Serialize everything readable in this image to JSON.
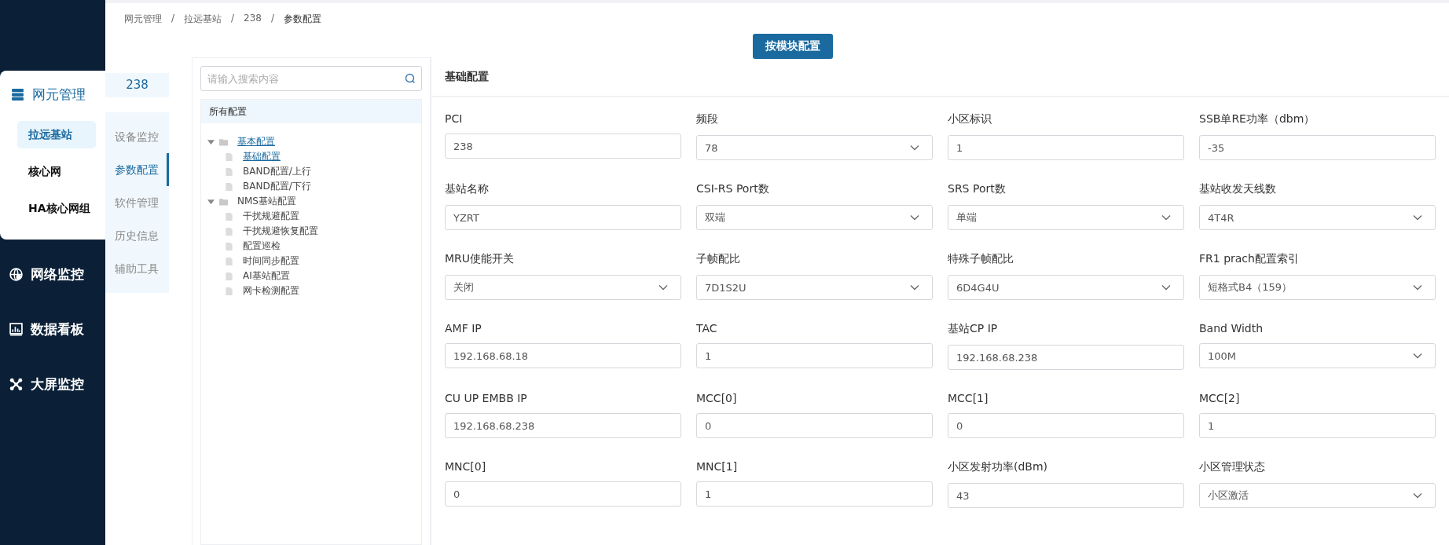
{
  "sidebar": {
    "items": [
      {
        "label": "网元管理",
        "expanded": true,
        "children": [
          {
            "label": "拉远基站",
            "selected": true
          },
          {
            "label": "核心网",
            "selected": false
          },
          {
            "label": "HA核心网组",
            "selected": false
          }
        ]
      },
      {
        "label": "网络监控",
        "expanded": false
      },
      {
        "label": "数据看板",
        "expanded": false
      },
      {
        "label": "大屏监控",
        "expanded": false
      }
    ]
  },
  "breadcrumb": {
    "separator": "/",
    "items": [
      "网元管理",
      "拉远基站",
      "238",
      "参数配置"
    ]
  },
  "module_button": "按模块配置",
  "subnav": {
    "title": "238",
    "items": [
      {
        "label": "设备监控",
        "selected": false
      },
      {
        "label": "参数配置",
        "selected": true
      },
      {
        "label": "软件管理",
        "selected": false
      },
      {
        "label": "历史信息",
        "selected": false
      },
      {
        "label": "辅助工具",
        "selected": false
      }
    ]
  },
  "tree": {
    "search": {
      "placeholder": "请输入搜索内容"
    },
    "header": "所有配置",
    "nodes": [
      {
        "label": "基本配置",
        "selected": true,
        "expanded": true,
        "children": [
          {
            "label": "基础配置",
            "selected": true
          },
          {
            "label": "BAND配置/上行",
            "selected": false
          },
          {
            "label": "BAND配置/下行",
            "selected": false
          }
        ]
      },
      {
        "label": "NMS基站配置",
        "selected": false,
        "expanded": true,
        "children": [
          {
            "label": "干扰规避配置",
            "selected": false
          },
          {
            "label": "干扰规避恢复配置",
            "selected": false
          },
          {
            "label": "配置巡检",
            "selected": false
          },
          {
            "label": "时间同步配置",
            "selected": false
          },
          {
            "label": "AI基站配置",
            "selected": false
          },
          {
            "label": "网卡检测配置",
            "selected": false
          }
        ]
      }
    ]
  },
  "form": {
    "title": "基础配置",
    "fields": [
      {
        "label": "PCI",
        "kind": "input",
        "value": "238"
      },
      {
        "label": "频段",
        "kind": "select",
        "value": "78"
      },
      {
        "label": "小区标识",
        "kind": "input",
        "value": "1"
      },
      {
        "label": "SSB单RE功率（dbm）",
        "kind": "input",
        "value": "-35"
      },
      {
        "label": "基站名称",
        "kind": "input",
        "value": "YZRT"
      },
      {
        "label": "CSI-RS Port数",
        "kind": "select",
        "value": "双端"
      },
      {
        "label": "SRS Port数",
        "kind": "select",
        "value": "单端"
      },
      {
        "label": "基站收发天线数",
        "kind": "select",
        "value": "4T4R"
      },
      {
        "label": "MRU使能开关",
        "kind": "select",
        "value": "关闭"
      },
      {
        "label": "子帧配比",
        "kind": "select",
        "value": "7D1S2U"
      },
      {
        "label": "特殊子帧配比",
        "kind": "select",
        "value": "6D4G4U"
      },
      {
        "label": "FR1 prach配置索引",
        "kind": "select",
        "value": "短格式B4（159）"
      },
      {
        "label": "AMF IP",
        "kind": "input",
        "value": "192.168.68.18"
      },
      {
        "label": "TAC",
        "kind": "input",
        "value": "1"
      },
      {
        "label": "基站CP IP",
        "kind": "input",
        "value": "192.168.68.238"
      },
      {
        "label": "Band Width",
        "kind": "select",
        "value": "100M"
      },
      {
        "label": "CU UP EMBB IP",
        "kind": "input",
        "value": "192.168.68.238"
      },
      {
        "label": "MCC[0]",
        "kind": "input",
        "value": "0"
      },
      {
        "label": "MCC[1]",
        "kind": "input",
        "value": "0"
      },
      {
        "label": "MCC[2]",
        "kind": "input",
        "value": "1"
      },
      {
        "label": "MNC[0]",
        "kind": "input",
        "value": "0"
      },
      {
        "label": "MNC[1]",
        "kind": "input",
        "value": "1"
      },
      {
        "label": "小区发射功率(dBm)",
        "kind": "input",
        "value": "43"
      },
      {
        "label": "小区管理状态",
        "kind": "select",
        "value": "小区激活"
      }
    ]
  }
}
